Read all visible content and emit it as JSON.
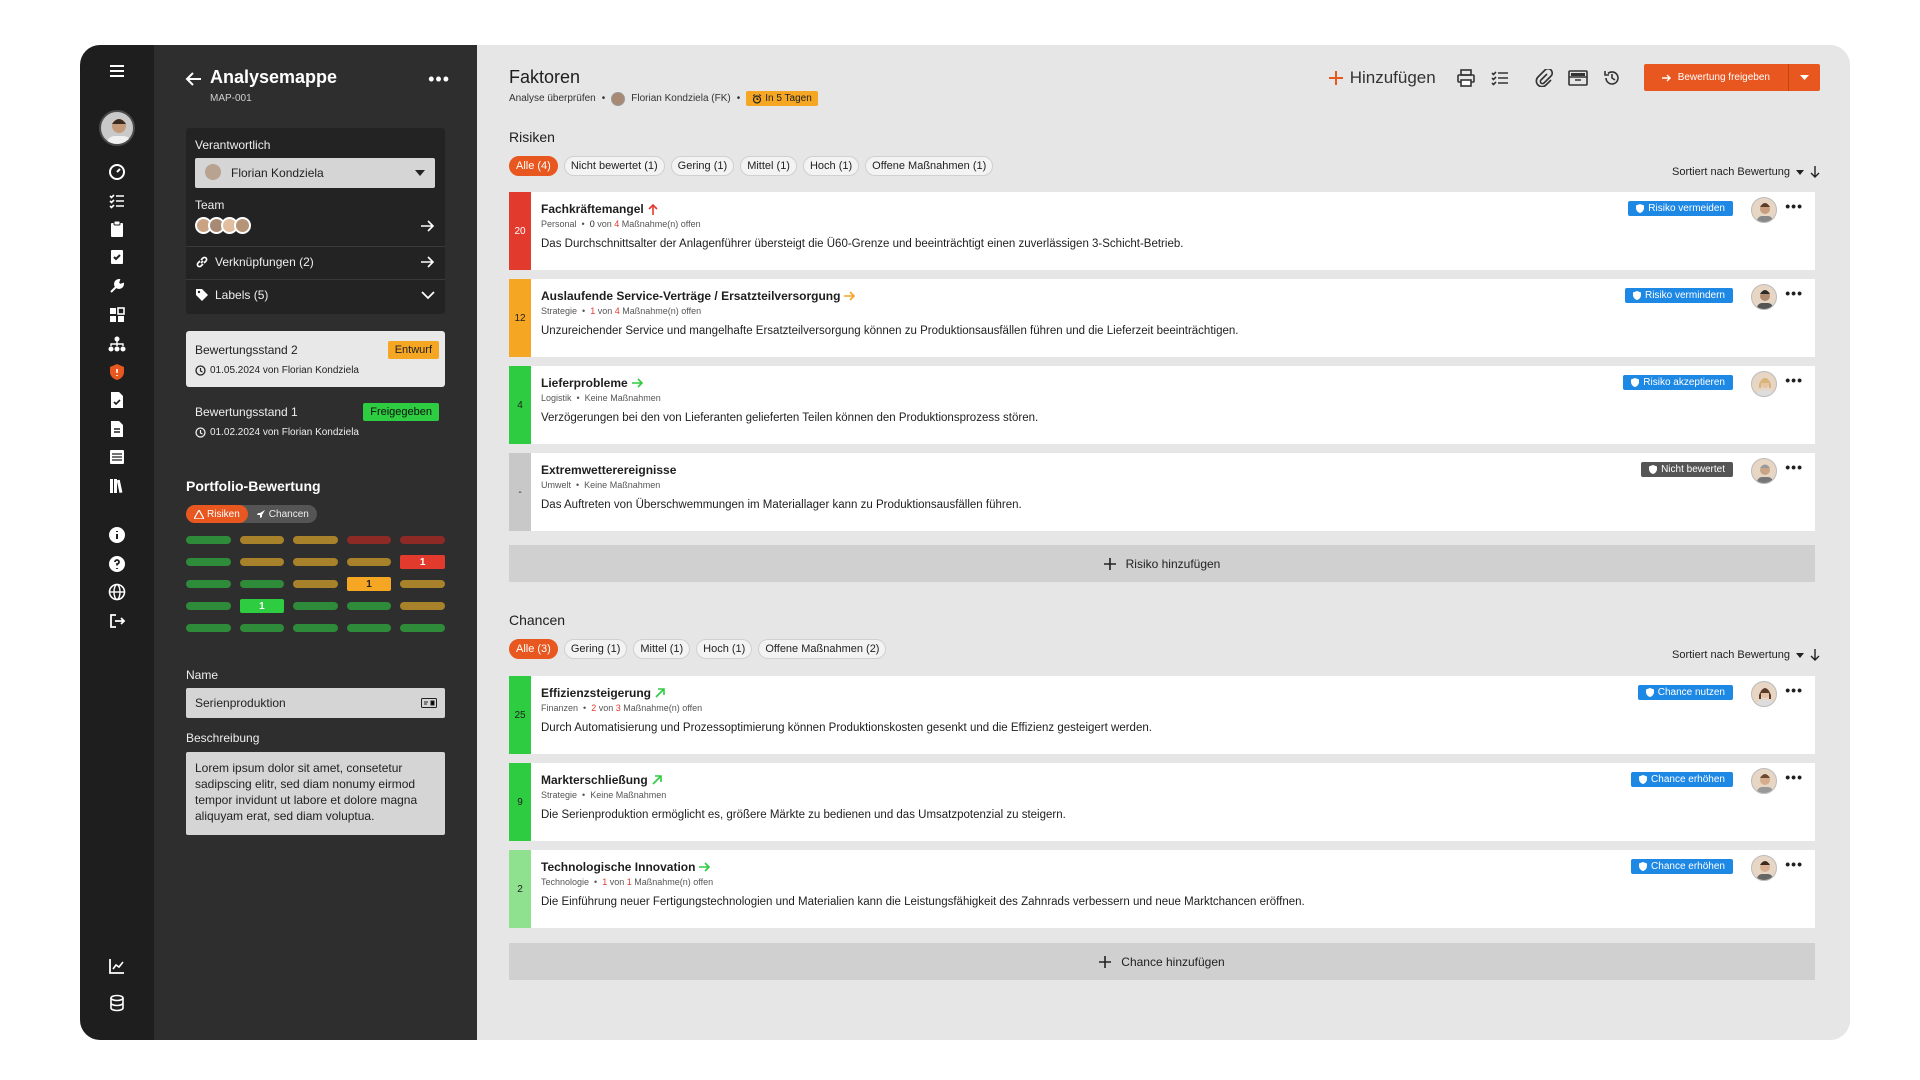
{
  "panel": {
    "title": "Analysemappe",
    "subtitle": "MAP-001",
    "responsible_label": "Verantwortlich",
    "responsible_value": "Florian Kondziela",
    "team_label": "Team",
    "links_label": "Verknüpfungen (2)",
    "labels_label": "Labels (5)",
    "versions": [
      {
        "title": "Bewertungsstand 2",
        "date": "01.05.2024 von Florian Kondziela",
        "badge": "Entwurf",
        "badge_color": "#f5a623"
      },
      {
        "title": "Bewertungsstand 1",
        "date": "01.02.2024 von Florian Kondziela",
        "badge": "Freigegeben",
        "badge_color": "#2ecc40"
      }
    ],
    "portfolio_title": "Portfolio-Bewertung",
    "toggle": {
      "risks": "Risiken",
      "chances": "Chancen"
    },
    "heat_values": {
      "r1": "1",
      "r2": "1",
      "r3": "1"
    },
    "name_label": "Name",
    "name_value": "Serienproduktion",
    "desc_label": "Beschreibung",
    "desc_value": "Lorem ipsum dolor sit amet, consetetur sadipscing elitr, sed diam nonumy eirmod tempor invidunt ut labore et dolore magna aliquyam erat, sed diam voluptua."
  },
  "header": {
    "title": "Faktoren",
    "meta_action": "Analyse überprüfen",
    "meta_user": "Florian Kondziela (FK)",
    "due": "In 5 Tagen",
    "add_label": "Hinzufügen",
    "release_label": "Bewertung freigeben"
  },
  "colors": {
    "accent": "#e8571f",
    "blue": "#1e88e5",
    "red": "#e23b2e",
    "orange": "#f5a623",
    "green": "#2ecc40",
    "lightgreen": "#8fe08f",
    "gray": "#c8c8c8"
  },
  "risks": {
    "title": "Risiken",
    "chips": [
      "Alle (4)",
      "Nicht bewertet (1)",
      "Gering (1)",
      "Mittel (1)",
      "Hoch (1)",
      "Offene Maßnahmen (1)"
    ],
    "sort": "Sortiert nach Bewertung",
    "add": "Risiko hinzufügen",
    "items": [
      {
        "score": "20",
        "title": "Fachkräftemangel",
        "category": "Personal",
        "meas_a": "0",
        "meas_mid": " von ",
        "meas_b": "4",
        "meas_rest": " Maßnahme(n) offen",
        "desc": "Das Durchschnittsalter der Anlagenführer übersteigt die Ü60-Grenze und beeinträchtigt einen zuverlässigen 3-Schicht-Betrieb.",
        "action": "Risiko vermeiden"
      },
      {
        "score": "12",
        "title": "Auslaufende Service-Verträge / Ersatzteilversorgung",
        "category": "Strategie",
        "meas_a": "1",
        "meas_mid": " von ",
        "meas_b": "4",
        "meas_rest": " Maßnahme(n) offen",
        "desc": "Unzureichender Service und mangelhafte Ersatzteilversorgung können zu Produktionsausfällen führen und die Lieferzeit beeinträchtigen.",
        "action": "Risiko vermindern"
      },
      {
        "score": "4",
        "title": "Lieferprobleme",
        "category": "Logistik",
        "meas_text": "Keine Maßnahmen",
        "desc": "Verzögerungen bei den von Lieferanten gelieferten Teilen können den Produktionsprozess stören.",
        "action": "Risiko akzeptieren"
      },
      {
        "score": "-",
        "title": "Extremwetterereignisse",
        "category": "Umwelt",
        "meas_text": "Keine Maßnahmen",
        "desc": "Das Auftreten von Überschwemmungen im Materiallager kann zu Produktionsausfällen führen.",
        "action": "Nicht bewertet"
      }
    ]
  },
  "chances": {
    "title": "Chancen",
    "chips": [
      "Alle (3)",
      "Gering (1)",
      "Mittel (1)",
      "Hoch (1)",
      "Offene Maßnahmen (2)"
    ],
    "sort": "Sortiert nach Bewertung",
    "add": "Chance hinzufügen",
    "items": [
      {
        "score": "25",
        "title": "Effizienzsteigerung",
        "category": "Finanzen",
        "meas_a": "2",
        "meas_mid": " von ",
        "meas_b": "3",
        "meas_rest": " Maßnahme(n) offen",
        "desc": "Durch Automatisierung und Prozessoptimierung können Produktionskosten gesenkt und die Effizienz gesteigert werden.",
        "action": "Chance nutzen"
      },
      {
        "score": "9",
        "title": "Markterschließung",
        "category": "Strategie",
        "meas_text": "Keine Maßnahmen",
        "desc": "Die Serienproduktion ermöglicht es, größere Märkte zu bedienen und das Umsatzpotenzial zu steigern.",
        "action": "Chance erhöhen"
      },
      {
        "score": "2",
        "title": "Technologische Innovation",
        "category": "Technologie",
        "meas_a": "1",
        "meas_mid": " von ",
        "meas_b": "1",
        "meas_rest": " Maßnahme(n) offen",
        "desc": "Die Einführung neuer Fertigungstechnologien und Materialien kann die Leistungsfähigkeit des Zahnrads verbessern und neue Marktchancen eröffnen.",
        "action": "Chance erhöhen"
      }
    ]
  }
}
